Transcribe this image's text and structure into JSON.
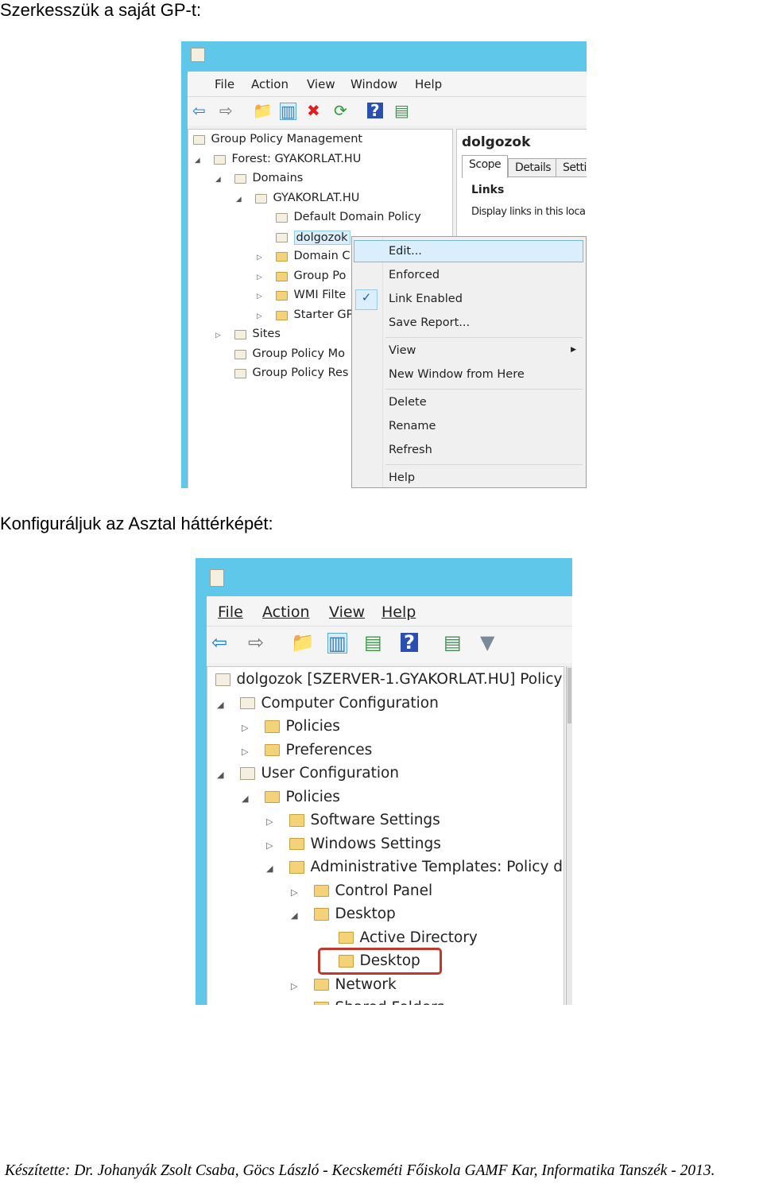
{
  "heading1": "Szerkesszük a saját GP-t:",
  "heading2": "Konfiguráljuk az Asztal háttérképét:",
  "footer": "Készítette: Dr. Johanyák Zsolt Csaba, Göcs László - Kecskeméti Főiskola GAMF Kar, Informatika Tanszék - 2013.",
  "colors": {
    "titlebar": "#5fc7ea",
    "highlight": "#dbeefb",
    "red_outline": "#c0392b"
  },
  "shot1": {
    "menu": [
      "File",
      "Action",
      "View",
      "Window",
      "Help"
    ],
    "toolbar_icons": [
      "back-arrow-icon",
      "forward-arrow-icon",
      "up-folder-icon",
      "show-hide-tree-icon",
      "delete-icon",
      "refresh-icon",
      "help-icon",
      "action-pane-icon"
    ],
    "tree": [
      {
        "level": 0,
        "toggle": "",
        "text": "Group Policy Management",
        "icon": "gpm-icon"
      },
      {
        "level": 1,
        "toggle": "open",
        "text": "Forest: GYAKORLAT.HU",
        "icon": "forest-icon"
      },
      {
        "level": 2,
        "toggle": "open",
        "text": "Domains",
        "icon": "domains-icon"
      },
      {
        "level": 3,
        "toggle": "open",
        "text": "GYAKORLAT.HU",
        "icon": "domain-icon"
      },
      {
        "level": 4,
        "toggle": "",
        "text": "Default Domain Policy",
        "icon": "gpo-link-icon"
      },
      {
        "level": 4,
        "toggle": "",
        "text": "dolgozok",
        "icon": "gpo-link-icon",
        "selected": true
      },
      {
        "level": 4,
        "toggle": "closed",
        "text": "Domain C",
        "icon": "folder-icon"
      },
      {
        "level": 4,
        "toggle": "closed",
        "text": "Group Po",
        "icon": "folder-icon"
      },
      {
        "level": 4,
        "toggle": "closed",
        "text": "WMI Filte",
        "icon": "folder-icon"
      },
      {
        "level": 4,
        "toggle": "closed",
        "text": "Starter GP",
        "icon": "folder-icon"
      },
      {
        "level": 2,
        "toggle": "closed",
        "text": "Sites",
        "icon": "sites-icon"
      },
      {
        "level": 2,
        "toggle": "",
        "text": "Group Policy Mo",
        "icon": "modeling-icon"
      },
      {
        "level": 2,
        "toggle": "",
        "text": "Group Policy Res",
        "icon": "results-icon"
      }
    ],
    "right": {
      "title": "dolgozok",
      "tabs": [
        "Scope",
        "Details",
        "Setti"
      ],
      "section": "Links",
      "desc": "Display links in this loca"
    },
    "context_menu": [
      {
        "label": "Edit...",
        "highlighted": true
      },
      {
        "label": "Enforced"
      },
      {
        "label": "Link Enabled",
        "checked": true
      },
      {
        "label": "Save Report..."
      },
      {
        "separator": true
      },
      {
        "label": "View",
        "submenu": true
      },
      {
        "label": "New Window from Here"
      },
      {
        "separator": true
      },
      {
        "label": "Delete"
      },
      {
        "label": "Rename"
      },
      {
        "label": "Refresh"
      },
      {
        "separator": true
      },
      {
        "label": "Help"
      }
    ]
  },
  "shot2": {
    "menu": [
      "File",
      "Action",
      "View",
      "Help"
    ],
    "toolbar_icons": [
      "back-arrow-icon",
      "forward-arrow-icon",
      "up-folder-icon",
      "show-hide-tree-icon",
      "export-list-icon",
      "help-icon",
      "action-pane-icon",
      "filter-icon"
    ],
    "tree": [
      {
        "level": 0,
        "toggle": "",
        "text": "dolgozok [SZERVER-1.GYAKORLAT.HU] Policy",
        "icon": "policy-icon"
      },
      {
        "level": 1,
        "toggle": "open",
        "text": "Computer Configuration",
        "icon": "computer-icon"
      },
      {
        "level": 2,
        "toggle": "closed",
        "text": "Policies",
        "icon": "folder-icon"
      },
      {
        "level": 2,
        "toggle": "closed",
        "text": "Preferences",
        "icon": "folder-icon"
      },
      {
        "level": 1,
        "toggle": "open",
        "text": "User Configuration",
        "icon": "users-icon"
      },
      {
        "level": 2,
        "toggle": "open",
        "text": "Policies",
        "icon": "folder-icon"
      },
      {
        "level": 3,
        "toggle": "closed",
        "text": "Software Settings",
        "icon": "folder-icon"
      },
      {
        "level": 3,
        "toggle": "closed",
        "text": "Windows Settings",
        "icon": "folder-icon"
      },
      {
        "level": 3,
        "toggle": "open",
        "text": "Administrative Templates: Policy def",
        "icon": "folder-icon"
      },
      {
        "level": 4,
        "toggle": "closed",
        "text": "Control Panel",
        "icon": "folder-icon"
      },
      {
        "level": 4,
        "toggle": "open",
        "text": "Desktop",
        "icon": "folder-icon"
      },
      {
        "level": 5,
        "toggle": "",
        "text": "Active Directory",
        "icon": "folder-icon"
      },
      {
        "level": 5,
        "toggle": "",
        "text": "Desktop",
        "icon": "folder-icon",
        "outlined": true
      },
      {
        "level": 4,
        "toggle": "closed",
        "text": "Network",
        "icon": "folder-icon"
      },
      {
        "level": 4,
        "toggle": "",
        "text": "Shared Folders",
        "icon": "folder-icon"
      }
    ]
  }
}
